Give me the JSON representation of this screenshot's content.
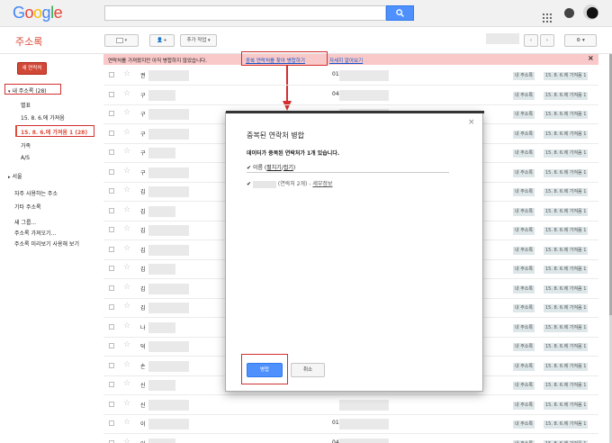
{
  "brand": {
    "logo_letters": [
      "G",
      "o",
      "o",
      "g",
      "l",
      "e"
    ],
    "logo_colors": [
      "#4285f4",
      "#ea4335",
      "#fbbc05",
      "#4285f4",
      "#34a853",
      "#ea4335"
    ]
  },
  "colors": {
    "accent_red": "#dd4b39",
    "button_red": "#d14836",
    "search_blue": "#4d90fe",
    "annotation_red": "#d32f2f",
    "notice_bg": "#f9c8c8",
    "label_bg": "#dde6e8"
  },
  "header": {
    "app_title": "주소록",
    "more_actions_label": "추가 작업",
    "settings_icon": "gear-icon"
  },
  "sidebar": {
    "new_contact": "새 연락처",
    "my_contacts": "내 주소록 (28)",
    "items": [
      "별표",
      "15. 8. 6.에 가져옴",
      "15. 8. 6.에 가져옴 1 (28)",
      "가족",
      "A/S"
    ],
    "group_seoul": "서울",
    "frequent": "자주 사용하는 주소",
    "other": "기타 주소록",
    "new_group": "새 그룹...",
    "import": "주소록 가져오기...",
    "preview": "주소록 미리보기 사용해 보기"
  },
  "notice": {
    "text": "연락처를 가져왔지만 아직 병합하지 않았습니다.",
    "find_link": "중복 연락처를 찾아 병합하기",
    "learn_link": "자세히 알아보기",
    "close": "×"
  },
  "contacts": {
    "initials": [
      "권",
      "구",
      "구",
      "구",
      "구",
      "구",
      "김",
      "김",
      "김",
      "김",
      "김",
      "김",
      "김",
      "나",
      "덕",
      "손",
      "신",
      "신",
      "이",
      "이"
    ],
    "label_my": "내 주소록",
    "label_import": "15. 8. 6.에 가져옴 1",
    "phone_prefixes": [
      "01",
      "04"
    ]
  },
  "dialog": {
    "title": "중복된 연락처 병합",
    "summary": "데이터가 중복된 연락처가 1개 있습니다.",
    "name_label": "이름",
    "expand_link": "펼치기",
    "collapse_link": "접기",
    "entry_count": "(연락처 2개) -",
    "details_link": "세부정보",
    "close": "×",
    "merge_button": "병합",
    "cancel_button": "취소"
  }
}
